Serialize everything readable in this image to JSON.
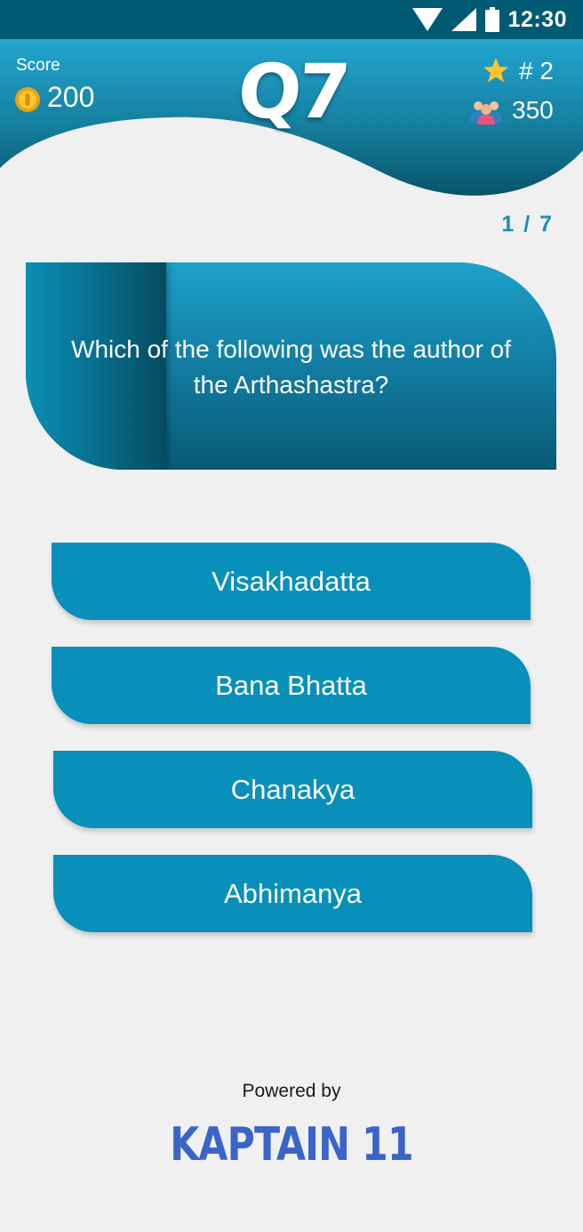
{
  "status_bar": {
    "time": "12:30",
    "icons": [
      "wifi-icon",
      "signal-icon",
      "battery-icon"
    ]
  },
  "header": {
    "score_label": "Score",
    "score_value": "200",
    "question_badge": "Q7",
    "rank": "# 2",
    "players": "350"
  },
  "progress": "1 / 7",
  "question": {
    "text": "Which of the following was the author of the Arthashastra?"
  },
  "answers": [
    {
      "label": "Visakhadatta"
    },
    {
      "label": "Bana Bhatta"
    },
    {
      "label": "Chanakya"
    },
    {
      "label": "Abhimanya"
    }
  ],
  "footer": {
    "powered_by": "Powered by",
    "brand": "KAPTAIN 11"
  },
  "colors": {
    "status_bar": "#005a73",
    "accent": "#0890ba",
    "brand": "#3a64c8",
    "background": "#f0f0f1"
  }
}
